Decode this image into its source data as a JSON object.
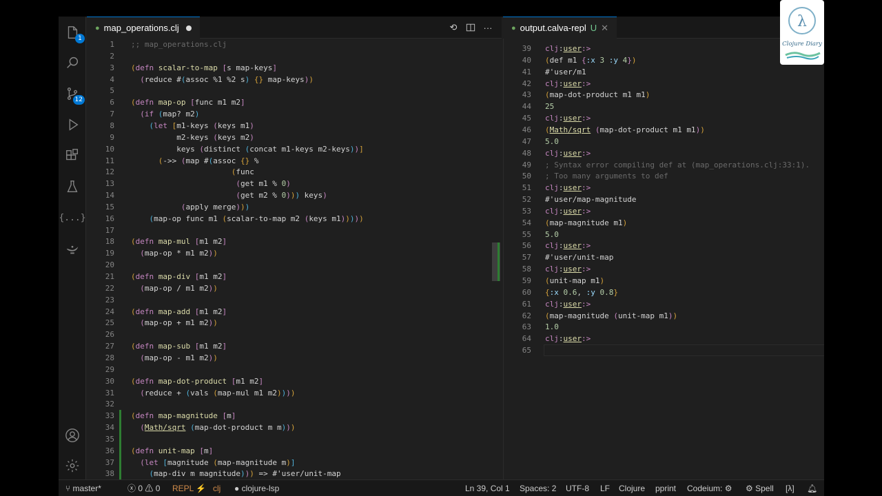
{
  "editor_tab": {
    "title": "map_operations.clj"
  },
  "repl_tab": {
    "title": "output.calva-repl",
    "modified": "U"
  },
  "activity": {
    "source_control_badge": "12",
    "explorer_badge": "1",
    "braces_label": "{...}"
  },
  "editor_lines": [
    {
      "n": "1",
      "t": [
        [
          "c-cm",
          ";; map_operations.clj"
        ]
      ]
    },
    {
      "n": "2",
      "t": []
    },
    {
      "n": "3",
      "t": [
        [
          "c-p1",
          "("
        ],
        [
          "c-kw",
          "defn "
        ],
        [
          "c-fn",
          "scalar-to-map "
        ],
        [
          "c-p2",
          "["
        ],
        [
          "",
          "s map-keys"
        ],
        [
          "c-p2",
          "]"
        ]
      ]
    },
    {
      "n": "4",
      "t": [
        [
          "",
          "  "
        ],
        [
          "c-p2",
          "("
        ],
        [
          "",
          "reduce #"
        ],
        [
          "c-p3",
          "("
        ],
        [
          "",
          "assoc %1 %2 s"
        ],
        [
          "c-p3",
          ")"
        ],
        [
          "c-p1",
          " {} "
        ],
        [
          "",
          "map-keys"
        ],
        [
          "c-p2",
          ")"
        ],
        [
          "c-p1",
          ")"
        ]
      ]
    },
    {
      "n": "5",
      "t": []
    },
    {
      "n": "6",
      "t": [
        [
          "c-p1",
          "("
        ],
        [
          "c-kw",
          "defn "
        ],
        [
          "c-fn",
          "map-op "
        ],
        [
          "c-p2",
          "["
        ],
        [
          "",
          "func m1 m2"
        ],
        [
          "c-p2",
          "]"
        ]
      ]
    },
    {
      "n": "7",
      "t": [
        [
          "",
          "  "
        ],
        [
          "c-p2",
          "("
        ],
        [
          "c-kw",
          "if "
        ],
        [
          "c-p3",
          "("
        ],
        [
          "",
          "map? m2"
        ],
        [
          "c-p3",
          ")"
        ]
      ]
    },
    {
      "n": "8",
      "t": [
        [
          "",
          "    "
        ],
        [
          "c-p3",
          "("
        ],
        [
          "c-kw",
          "let "
        ],
        [
          "c-p1",
          "["
        ],
        [
          "",
          "m1-keys "
        ],
        [
          "c-p2",
          "("
        ],
        [
          "",
          "keys m1"
        ],
        [
          "c-p2",
          ")"
        ]
      ]
    },
    {
      "n": "9",
      "t": [
        [
          "",
          "          m2-keys "
        ],
        [
          "c-p2",
          "("
        ],
        [
          "",
          "keys m2"
        ],
        [
          "c-p2",
          ")"
        ]
      ]
    },
    {
      "n": "10",
      "t": [
        [
          "",
          "          keys "
        ],
        [
          "c-p2",
          "("
        ],
        [
          "",
          "distinct "
        ],
        [
          "c-p3",
          "("
        ],
        [
          "",
          "concat m1-keys m2-keys"
        ],
        [
          "c-p3",
          ")"
        ],
        [
          "c-p2",
          ")"
        ],
        [
          "c-p1",
          "]"
        ]
      ]
    },
    {
      "n": "11",
      "t": [
        [
          "",
          "      "
        ],
        [
          "c-p1",
          "("
        ],
        [
          "",
          "->> "
        ],
        [
          "c-p2",
          "("
        ],
        [
          "",
          "map #"
        ],
        [
          "c-p3",
          "("
        ],
        [
          "",
          "assoc "
        ],
        [
          "c-p1",
          "{}"
        ],
        [
          "",
          " %"
        ]
      ]
    },
    {
      "n": "12",
      "t": [
        [
          "",
          "                      "
        ],
        [
          "c-p1",
          "("
        ],
        [
          "",
          "func"
        ]
      ]
    },
    {
      "n": "13",
      "t": [
        [
          "",
          "                       "
        ],
        [
          "c-p2",
          "("
        ],
        [
          "",
          "get m1 % "
        ],
        [
          "c-num",
          "0"
        ],
        [
          "c-p2",
          ")"
        ]
      ]
    },
    {
      "n": "14",
      "t": [
        [
          "",
          "                       "
        ],
        [
          "c-p2",
          "("
        ],
        [
          "",
          "get m2 % "
        ],
        [
          "c-num",
          "0"
        ],
        [
          "c-p2",
          ")"
        ],
        [
          "c-p1",
          ")"
        ],
        [
          "c-p3",
          ")"
        ],
        [
          "",
          " keys"
        ],
        [
          "c-p2",
          ")"
        ]
      ]
    },
    {
      "n": "15",
      "t": [
        [
          "",
          "           "
        ],
        [
          "c-p2",
          "("
        ],
        [
          "",
          "apply merge"
        ],
        [
          "c-p2",
          ")"
        ],
        [
          "c-p1",
          ")"
        ],
        [
          "c-p3",
          ")"
        ]
      ]
    },
    {
      "n": "16",
      "t": [
        [
          "",
          "    "
        ],
        [
          "c-p3",
          "("
        ],
        [
          "",
          "map-op func m1 "
        ],
        [
          "c-p1",
          "("
        ],
        [
          "",
          "scalar-to-map m2 "
        ],
        [
          "c-p2",
          "("
        ],
        [
          "",
          "keys m1"
        ],
        [
          "c-p2",
          ")"
        ],
        [
          "c-p1",
          ")"
        ],
        [
          "c-p3",
          ")"
        ],
        [
          "c-p2",
          ")"
        ],
        [
          "c-p1",
          ")"
        ]
      ]
    },
    {
      "n": "17",
      "t": []
    },
    {
      "n": "18",
      "t": [
        [
          "c-p1",
          "("
        ],
        [
          "c-kw",
          "defn "
        ],
        [
          "c-fn",
          "map-mul "
        ],
        [
          "c-p2",
          "["
        ],
        [
          "",
          "m1 m2"
        ],
        [
          "c-p2",
          "]"
        ]
      ]
    },
    {
      "n": "19",
      "t": [
        [
          "",
          "  "
        ],
        [
          "c-p2",
          "("
        ],
        [
          "",
          "map-op * m1 m2"
        ],
        [
          "c-p2",
          ")"
        ],
        [
          "c-p1",
          ")"
        ]
      ]
    },
    {
      "n": "20",
      "t": []
    },
    {
      "n": "21",
      "t": [
        [
          "c-p1",
          "("
        ],
        [
          "c-kw",
          "defn "
        ],
        [
          "c-fn",
          "map-div "
        ],
        [
          "c-p2",
          "["
        ],
        [
          "",
          "m1 m2"
        ],
        [
          "c-p2",
          "]"
        ]
      ]
    },
    {
      "n": "22",
      "t": [
        [
          "",
          "  "
        ],
        [
          "c-p2",
          "("
        ],
        [
          "",
          "map-op / m1 m2"
        ],
        [
          "c-p2",
          ")"
        ],
        [
          "c-p1",
          ")"
        ]
      ]
    },
    {
      "n": "23",
      "t": []
    },
    {
      "n": "24",
      "t": [
        [
          "c-p1",
          "("
        ],
        [
          "c-kw",
          "defn "
        ],
        [
          "c-fn",
          "map-add "
        ],
        [
          "c-p2",
          "["
        ],
        [
          "",
          "m1 m2"
        ],
        [
          "c-p2",
          "]"
        ]
      ]
    },
    {
      "n": "25",
      "t": [
        [
          "",
          "  "
        ],
        [
          "c-p2",
          "("
        ],
        [
          "",
          "map-op + m1 m2"
        ],
        [
          "c-p2",
          ")"
        ],
        [
          "c-p1",
          ")"
        ]
      ]
    },
    {
      "n": "26",
      "t": []
    },
    {
      "n": "27",
      "t": [
        [
          "c-p1",
          "("
        ],
        [
          "c-kw",
          "defn "
        ],
        [
          "c-fn",
          "map-sub "
        ],
        [
          "c-p2",
          "["
        ],
        [
          "",
          "m1 m2"
        ],
        [
          "c-p2",
          "]"
        ]
      ]
    },
    {
      "n": "28",
      "t": [
        [
          "",
          "  "
        ],
        [
          "c-p2",
          "("
        ],
        [
          "",
          "map-op - m1 m2"
        ],
        [
          "c-p2",
          ")"
        ],
        [
          "c-p1",
          ")"
        ]
      ]
    },
    {
      "n": "29",
      "t": []
    },
    {
      "n": "30",
      "t": [
        [
          "c-p1",
          "("
        ],
        [
          "c-kw",
          "defn "
        ],
        [
          "c-fn",
          "map-dot-product "
        ],
        [
          "c-p2",
          "["
        ],
        [
          "",
          "m1 m2"
        ],
        [
          "c-p2",
          "]"
        ]
      ]
    },
    {
      "n": "31",
      "t": [
        [
          "",
          "  "
        ],
        [
          "c-p2",
          "("
        ],
        [
          "",
          "reduce + "
        ],
        [
          "c-p3",
          "("
        ],
        [
          "",
          "vals "
        ],
        [
          "c-p1",
          "("
        ],
        [
          "",
          "map-mul m1 m2"
        ],
        [
          "c-p1",
          ")"
        ],
        [
          "c-p3",
          ")"
        ],
        [
          "c-p2",
          ")"
        ],
        [
          "c-p1",
          ")"
        ]
      ]
    },
    {
      "n": "32",
      "t": []
    },
    {
      "n": "33",
      "t": [
        [
          "c-p1",
          "("
        ],
        [
          "c-kw",
          "defn "
        ],
        [
          "c-fn",
          "map-magnitude "
        ],
        [
          "c-p2",
          "["
        ],
        [
          "",
          "m"
        ],
        [
          "c-p2",
          "]"
        ]
      ]
    },
    {
      "n": "34",
      "t": [
        [
          "",
          "  "
        ],
        [
          "c-p2",
          "("
        ],
        [
          "c-ns",
          "Math/sqrt"
        ],
        [
          "",
          " "
        ],
        [
          "c-p3",
          "("
        ],
        [
          "",
          "map-dot-product m m"
        ],
        [
          "c-p3",
          ")"
        ],
        [
          "c-p2",
          ")"
        ],
        [
          "c-p1",
          ")"
        ]
      ]
    },
    {
      "n": "35",
      "t": []
    },
    {
      "n": "36",
      "t": [
        [
          "c-p1",
          "("
        ],
        [
          "c-kw",
          "defn "
        ],
        [
          "c-fn",
          "unit-map "
        ],
        [
          "c-p2",
          "["
        ],
        [
          "",
          "m"
        ],
        [
          "c-p2",
          "]"
        ]
      ]
    },
    {
      "n": "37",
      "t": [
        [
          "",
          "  "
        ],
        [
          "c-p2",
          "("
        ],
        [
          "c-kw",
          "let "
        ],
        [
          "c-p3",
          "["
        ],
        [
          "",
          "magnitude "
        ],
        [
          "c-p1",
          "("
        ],
        [
          "",
          "map-magnitude m"
        ],
        [
          "c-p1",
          ")"
        ],
        [
          "c-p3",
          "]"
        ]
      ]
    },
    {
      "n": "38",
      "t": [
        [
          "",
          "    "
        ],
        [
          "c-p3",
          "("
        ],
        [
          "",
          "map-div m magnitude"
        ],
        [
          "c-p3",
          ")"
        ],
        [
          "c-p2",
          ")"
        ],
        [
          "c-p1",
          ")"
        ],
        [
          "",
          " => #'user/unit-map"
        ]
      ]
    }
  ],
  "repl_lines": [
    {
      "n": "39",
      "t": [
        [
          "c-prompt",
          "clj"
        ],
        [
          "",
          "꞉"
        ],
        [
          "c-ns",
          "user"
        ],
        [
          "c-prompt",
          "꞉>"
        ]
      ]
    },
    {
      "n": "40",
      "t": [
        [
          "c-p1",
          "("
        ],
        [
          "",
          "def m1 "
        ],
        [
          "c-p2",
          "{"
        ],
        [
          "c-kwd",
          ":x "
        ],
        [
          "c-num",
          "3"
        ],
        [
          "c-kwd",
          " :y "
        ],
        [
          "c-num",
          "4"
        ],
        [
          "c-p2",
          "}"
        ],
        [
          "c-p1",
          ")"
        ]
      ]
    },
    {
      "n": "41",
      "t": [
        [
          "",
          "#'user/m1"
        ]
      ]
    },
    {
      "n": "42",
      "t": [
        [
          "c-prompt",
          "clj"
        ],
        [
          "",
          "꞉"
        ],
        [
          "c-ns",
          "user"
        ],
        [
          "c-prompt",
          "꞉>"
        ]
      ]
    },
    {
      "n": "43",
      "t": [
        [
          "c-p1",
          "("
        ],
        [
          "",
          "map-dot-product m1 m1"
        ],
        [
          "c-p1",
          ")"
        ]
      ]
    },
    {
      "n": "44",
      "t": [
        [
          "c-res",
          "25"
        ]
      ]
    },
    {
      "n": "45",
      "t": [
        [
          "c-prompt",
          "clj"
        ],
        [
          "",
          "꞉"
        ],
        [
          "c-ns",
          "user"
        ],
        [
          "c-prompt",
          "꞉>"
        ]
      ]
    },
    {
      "n": "46",
      "t": [
        [
          "c-p1",
          "("
        ],
        [
          "c-ns",
          "Math/sqrt"
        ],
        [
          "",
          " "
        ],
        [
          "c-p2",
          "("
        ],
        [
          "",
          "map-dot-product m1 m1"
        ],
        [
          "c-p2",
          ")"
        ],
        [
          "c-p1",
          ")"
        ]
      ]
    },
    {
      "n": "47",
      "t": [
        [
          "c-res",
          "5.0"
        ]
      ]
    },
    {
      "n": "48",
      "t": [
        [
          "c-prompt",
          "clj"
        ],
        [
          "",
          "꞉"
        ],
        [
          "c-ns",
          "user"
        ],
        [
          "c-prompt",
          "꞉>"
        ]
      ]
    },
    {
      "n": "49",
      "t": [
        [
          "c-cm",
          "; Syntax error compiling def at (map_operations.clj:33:1)."
        ]
      ]
    },
    {
      "n": "50",
      "t": [
        [
          "c-cm",
          "; Too many arguments to def"
        ]
      ]
    },
    {
      "n": "51",
      "t": [
        [
          "c-prompt",
          "clj"
        ],
        [
          "",
          "꞉"
        ],
        [
          "c-ns",
          "user"
        ],
        [
          "c-prompt",
          "꞉>"
        ]
      ]
    },
    {
      "n": "52",
      "t": [
        [
          "",
          "#'user/map-magnitude"
        ]
      ]
    },
    {
      "n": "53",
      "t": [
        [
          "c-prompt",
          "clj"
        ],
        [
          "",
          "꞉"
        ],
        [
          "c-ns",
          "user"
        ],
        [
          "c-prompt",
          "꞉>"
        ]
      ]
    },
    {
      "n": "54",
      "t": [
        [
          "c-p1",
          "("
        ],
        [
          "",
          "map-magnitude m1"
        ],
        [
          "c-p1",
          ")"
        ]
      ]
    },
    {
      "n": "55",
      "t": [
        [
          "c-res",
          "5.0"
        ]
      ]
    },
    {
      "n": "56",
      "t": [
        [
          "c-prompt",
          "clj"
        ],
        [
          "",
          "꞉"
        ],
        [
          "c-ns",
          "user"
        ],
        [
          "c-prompt",
          "꞉>"
        ]
      ]
    },
    {
      "n": "57",
      "t": [
        [
          "",
          "#'user/unit-map"
        ]
      ]
    },
    {
      "n": "58",
      "t": [
        [
          "c-prompt",
          "clj"
        ],
        [
          "",
          "꞉"
        ],
        [
          "c-ns",
          "user"
        ],
        [
          "c-prompt",
          "꞉>"
        ]
      ]
    },
    {
      "n": "59",
      "t": [
        [
          "c-p1",
          "("
        ],
        [
          "",
          "unit-map m1"
        ],
        [
          "c-p1",
          ")"
        ]
      ]
    },
    {
      "n": "60",
      "t": [
        [
          "c-p1",
          "{"
        ],
        [
          "c-kwd",
          ":x "
        ],
        [
          "c-num",
          "0.6"
        ],
        [
          "",
          ", "
        ],
        [
          "c-kwd",
          ":y "
        ],
        [
          "c-num",
          "0.8"
        ],
        [
          "c-p1",
          "}"
        ]
      ]
    },
    {
      "n": "61",
      "t": [
        [
          "c-prompt",
          "clj"
        ],
        [
          "",
          "꞉"
        ],
        [
          "c-ns",
          "user"
        ],
        [
          "c-prompt",
          "꞉>"
        ]
      ]
    },
    {
      "n": "62",
      "t": [
        [
          "c-p1",
          "("
        ],
        [
          "",
          "map-magnitude "
        ],
        [
          "c-p2",
          "("
        ],
        [
          "",
          "unit-map m1"
        ],
        [
          "c-p2",
          ")"
        ],
        [
          "c-p1",
          ")"
        ]
      ]
    },
    {
      "n": "63",
      "t": [
        [
          "c-res",
          "1.0"
        ]
      ]
    },
    {
      "n": "64",
      "t": [
        [
          "c-prompt",
          "clj"
        ],
        [
          "",
          "꞉"
        ],
        [
          "c-ns",
          "user"
        ],
        [
          "c-prompt",
          "꞉>"
        ]
      ]
    },
    {
      "n": "65",
      "t": []
    }
  ],
  "status": {
    "branch": "master*",
    "errors": "0",
    "warnings": "0",
    "repl": "REPL",
    "lang_short": "clj",
    "lsp": "clojure-lsp",
    "position": "Ln 39, Col 1",
    "spaces": "Spaces: 2",
    "encoding": "UTF-8",
    "eol": "LF",
    "language": "Clojure",
    "formatter": "pprint",
    "codeium": "Codeium:",
    "spell": "Spell",
    "lambda": "[λ]"
  },
  "logo": {
    "title": "Clojure Diary"
  },
  "colors": {
    "accent": "#0078d4",
    "background": "#1f1f1f",
    "keyword": "#c586c0",
    "function": "#dcdcaa"
  }
}
